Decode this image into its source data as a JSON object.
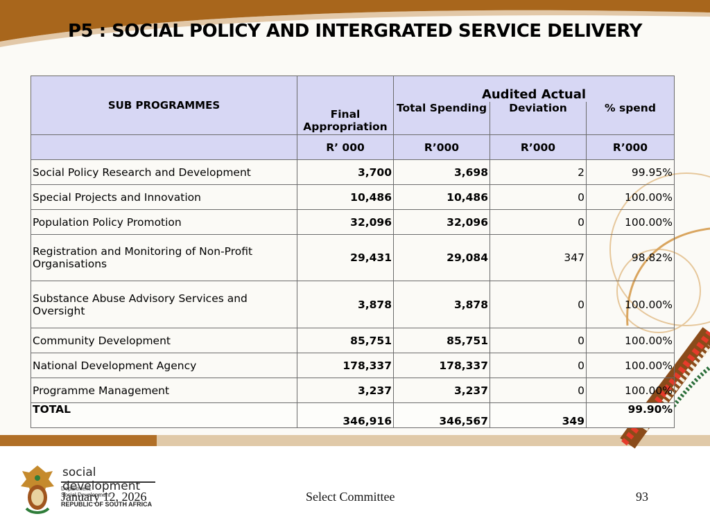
{
  "title": "P5 : SOCIAL POLICY AND INTERGRATED SERVICE DELIVERY",
  "table": {
    "headers": {
      "sub_programmes": "SUB PROGRAMMES",
      "final_appropriation": "Final Appropriation",
      "audited_actual": "Audited Actual",
      "total_spending": "Total Spending",
      "deviation": "Deviation",
      "pct_spend": "% spend"
    },
    "units": [
      "R’ 000",
      "R’000",
      "R’000",
      "R’000"
    ],
    "rows": [
      {
        "name": "Social Policy Research and Development",
        "final": "3,700",
        "spending": "3,698",
        "deviation": "2",
        "pct": "99.95%"
      },
      {
        "name": "Special Projects and Innovation",
        "final": "10,486",
        "spending": "10,486",
        "deviation": "0",
        "pct": "100.00%"
      },
      {
        "name": "Population Policy Promotion",
        "final": "32,096",
        "spending": "32,096",
        "deviation": "0",
        "pct": "100.00%"
      },
      {
        "name": "Registration and Monitoring of Non-Profit Organisations",
        "final": "29,431",
        "spending": "29,084",
        "deviation": "347",
        "pct": "98.82%"
      },
      {
        "name": "Substance Abuse Advisory Services and Oversight",
        "final": "3,878",
        "spending": "3,878",
        "deviation": "0",
        "pct": "100.00%"
      },
      {
        "name": "Community Development",
        "final": "85,751",
        "spending": "85,751",
        "deviation": "0",
        "pct": "100.00%"
      },
      {
        "name": "National Development Agency",
        "final": "178,337",
        "spending": "178,337",
        "deviation": "0",
        "pct": "100.00%"
      },
      {
        "name": "Programme Management",
        "final": "3,237",
        "spending": "3,237",
        "deviation": "0",
        "pct": "100.00%"
      }
    ],
    "total": {
      "name": "TOTAL",
      "final": "346,916",
      "spending": "346,567",
      "deviation": "349",
      "pct": "99.90%"
    }
  },
  "footer": {
    "date": "January 12, 2026",
    "center": "Select Committee",
    "page": "93"
  },
  "logo": {
    "name": "social development",
    "dept": "Department:",
    "dept2": "Social Development",
    "country": "REPUBLIC OF SOUTH AFRICA"
  },
  "colors": {
    "header_bg": "#d7d7f4",
    "banner": "#a8661c"
  }
}
